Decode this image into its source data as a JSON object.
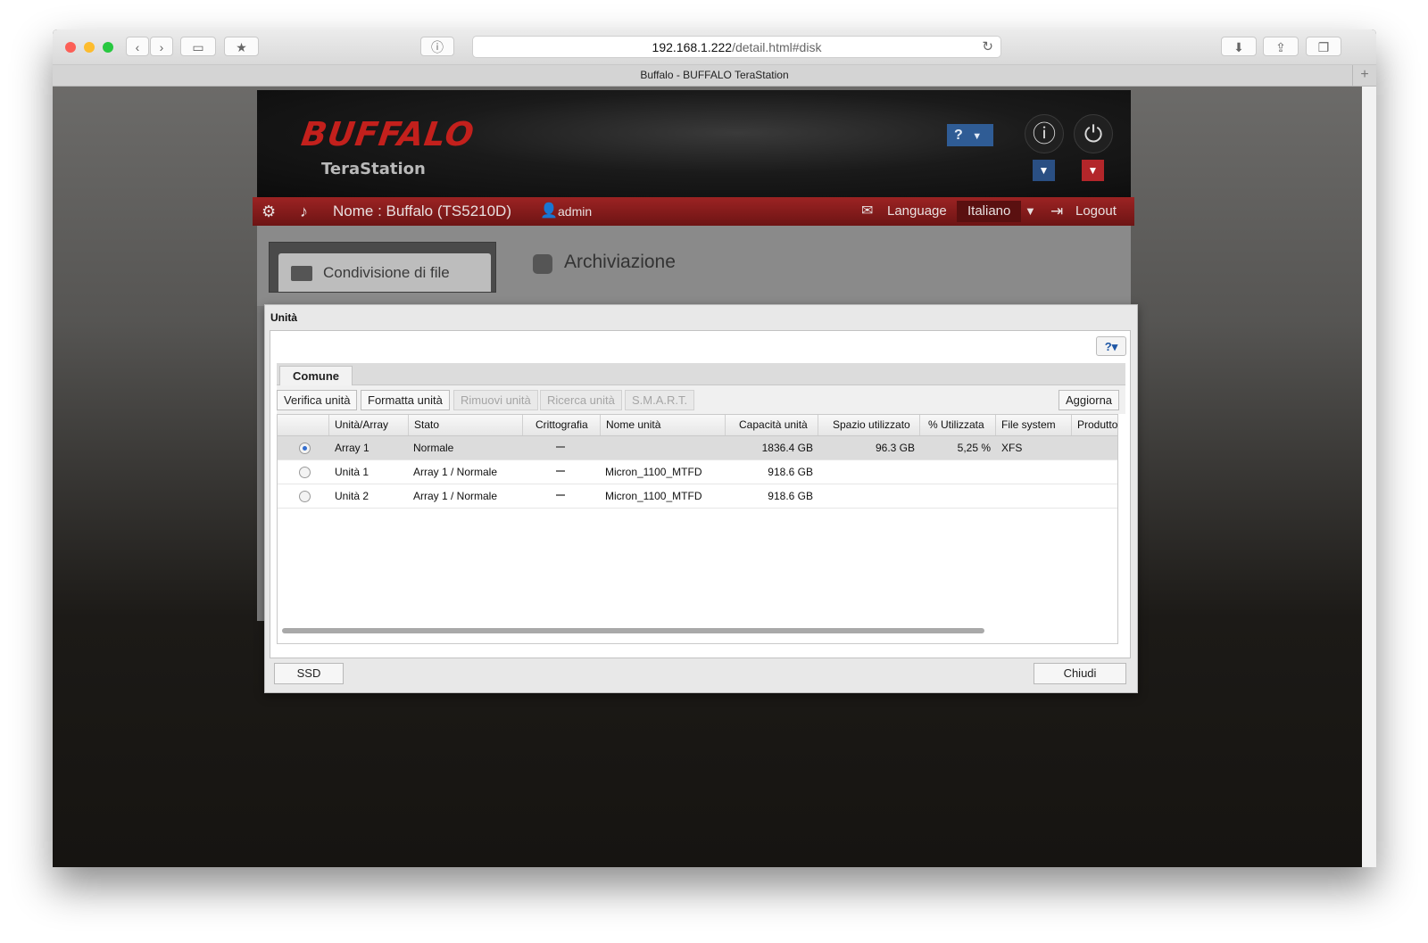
{
  "browser": {
    "url_host": "192.168.1.222",
    "url_path": "/detail.html#disk",
    "tab_title": "Buffalo - BUFFALO TeraStation"
  },
  "app": {
    "logo": "BUFFALO",
    "product": "TeraStation",
    "help_label": "?",
    "nas_name": "Nome : Buffalo (TS5210D)",
    "user": "admin",
    "language_label": "Language",
    "language_value": "Italiano",
    "logout": "Logout",
    "nav_item": "Condivisione di file",
    "section_title": "Archiviazione"
  },
  "dialog": {
    "title": "Unità",
    "tab": "Comune",
    "buttons": {
      "verify": "Verifica unità",
      "format": "Formatta unità",
      "remove": "Rimuovi unità",
      "rescan": "Ricerca unità",
      "smart": "S.M.A.R.T.",
      "refresh": "Aggiorna"
    },
    "columns": [
      "Unità/Array",
      "Stato",
      "Crittografia",
      "Nome unità",
      "Capacità unità",
      "Spazio utilizzato",
      "% Utilizzata",
      "File system",
      "Produttore"
    ],
    "rows": [
      {
        "unit": "Array 1",
        "state": "Normale",
        "name": "",
        "capacity": "1836.4 GB",
        "used": "96.3 GB",
        "pct": "5,25 %",
        "fs": "XFS",
        "selected": true
      },
      {
        "unit": "Unità 1",
        "state": "Array 1 / Normale",
        "name": "Micron_1100_MTFD",
        "capacity": "918.6 GB",
        "used": "",
        "pct": "",
        "fs": "",
        "selected": false
      },
      {
        "unit": "Unità 2",
        "state": "Array 1 / Normale",
        "name": "Micron_1100_MTFD",
        "capacity": "918.6 GB",
        "used": "",
        "pct": "",
        "fs": "",
        "selected": false
      }
    ],
    "footer": {
      "ssd": "SSD",
      "close": "Chiudi"
    }
  },
  "colors": {
    "brand_red": "#c3201c",
    "bar_red": "#8a1d1d",
    "help_blue": "#2f5c95"
  }
}
